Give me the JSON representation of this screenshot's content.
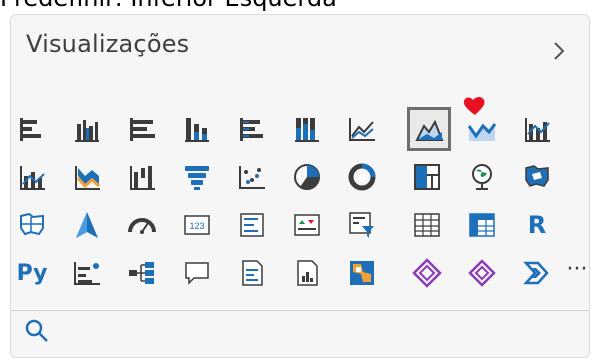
{
  "caption": "Predefinir: Inferior Esquerda",
  "panel": {
    "title": "Visualizações",
    "icons": [
      "stacked-bar-chart",
      "clustered-bar-chart",
      "stacked-bar-100-chart",
      "stacked-column-chart",
      "clustered-column-chart",
      "stacked-column-100-chart",
      "line-chart",
      "area-chart",
      "stacked-area-chart",
      "line-and-stacked-column-chart",
      "line-and-clustered-column-chart",
      "ribbon-chart",
      "waterfall-chart",
      "funnel-chart",
      "scatter-chart",
      "pie-chart",
      "donut-chart",
      "treemap",
      "map",
      "filled-map",
      "shape-map",
      "azure-map",
      "gauge",
      "card",
      "multi-row-card",
      "kpi",
      "slicer",
      "table",
      "matrix",
      "r-visual",
      "python-visual",
      "key-influencers",
      "decomposition-tree",
      "qna",
      "smart-narrative",
      "paginated-report",
      "power-apps",
      "power-automate",
      "diamond-visual",
      "chevron-visual",
      "more-options"
    ],
    "r_label": "R",
    "py_label": "Py",
    "more_label": "···"
  },
  "colors": {
    "accent": "#1d6fb8",
    "dark": "#3c3c3c",
    "heart": "#e81123"
  }
}
